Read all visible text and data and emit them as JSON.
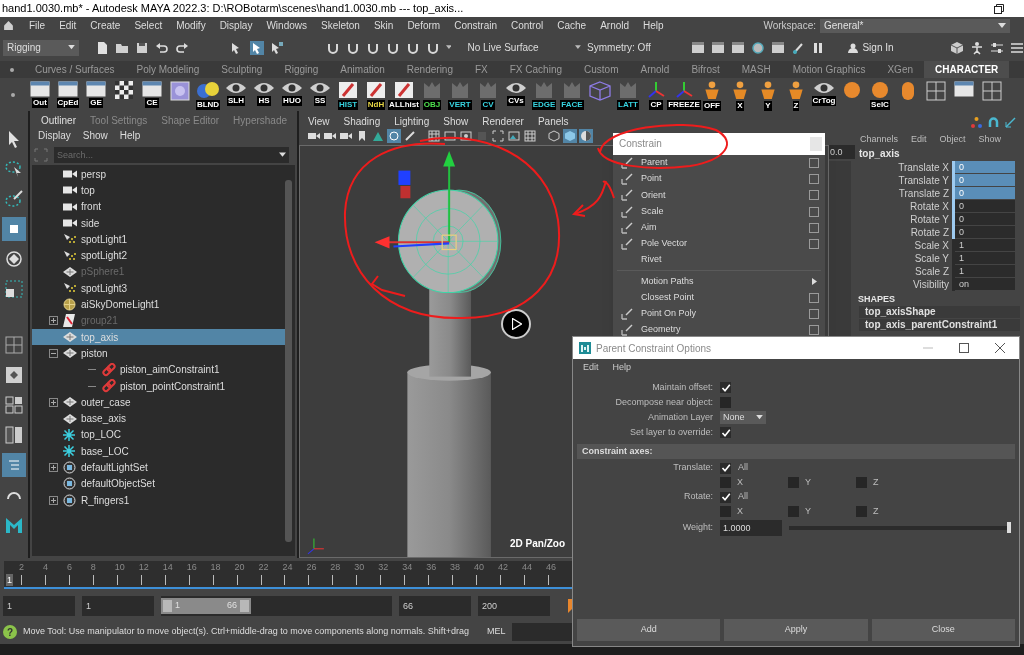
{
  "window": {
    "title": "hand1.0030.mb* - Autodesk MAYA 2022.3: D:\\ROBotarm\\scenes\\hand1.0030.mb   ---   top_axis..."
  },
  "menu_bar": {
    "items": [
      "File",
      "Edit",
      "Create",
      "Select",
      "Modify",
      "Display",
      "Windows",
      "Skeleton",
      "Skin",
      "Deform",
      "Constrain",
      "Control",
      "Cache",
      "Arnold",
      "Help"
    ],
    "workspace_label": "Workspace:",
    "workspace_value": "General*"
  },
  "status_line": {
    "menu_set": "Rigging",
    "live_surface": "No Live Surface",
    "symmetry": "Symmetry: Off",
    "sign_in": "Sign In"
  },
  "shelf": {
    "tabs": [
      {
        "label": "Curves / Surfaces",
        "selected": false
      },
      {
        "label": "Poly Modeling",
        "selected": false
      },
      {
        "label": "Sculpting",
        "selected": false
      },
      {
        "label": "Rigging",
        "selected": false
      },
      {
        "label": "Animation",
        "selected": false
      },
      {
        "label": "Rendering",
        "selected": false
      },
      {
        "label": "FX",
        "selected": false
      },
      {
        "label": "FX Caching",
        "selected": false
      },
      {
        "label": "Custom",
        "selected": false
      },
      {
        "label": "Arnold",
        "selected": false
      },
      {
        "label": "Bifrost",
        "selected": false
      },
      {
        "label": "MASH",
        "selected": false
      },
      {
        "label": "Motion Graphics",
        "selected": false
      },
      {
        "label": "XGen",
        "selected": false
      },
      {
        "label": "CHARACTER",
        "selected": true
      }
    ],
    "buttons": [
      {
        "kind": "window",
        "label": "Out"
      },
      {
        "kind": "window",
        "label": "CpEd"
      },
      {
        "kind": "window",
        "label": "GE"
      },
      {
        "kind": "checker"
      },
      {
        "kind": "window",
        "label": "CE"
      },
      {
        "kind": "swatch"
      },
      {
        "kind": "spheres",
        "label": "BLND"
      },
      {
        "kind": "eye",
        "label": "SLH"
      },
      {
        "kind": "eye",
        "label": "HS"
      },
      {
        "kind": "eye",
        "label": "HUO"
      },
      {
        "kind": "eye",
        "label": "SS"
      },
      {
        "kind": "history",
        "label": "HIST"
      },
      {
        "kind": "nodehistory",
        "label": "NdH"
      },
      {
        "kind": "allhistory",
        "label": "ALLhist"
      },
      {
        "kind": "object",
        "label": "OBJ"
      },
      {
        "kind": "component",
        "label": "VERT"
      },
      {
        "kind": "component",
        "label": "CV"
      },
      {
        "kind": "eye",
        "label": "CVs"
      },
      {
        "kind": "component",
        "label": "EDGE"
      },
      {
        "kind": "component",
        "label": "FACE"
      },
      {
        "kind": "cube"
      },
      {
        "kind": "component",
        "label": "LATT"
      },
      {
        "kind": "axes",
        "label": "CP"
      },
      {
        "kind": "axes",
        "label": "FREEZE"
      },
      {
        "kind": "figure",
        "label": "OFF"
      },
      {
        "kind": "figure",
        "label": "X"
      },
      {
        "kind": "figure",
        "label": "Y"
      },
      {
        "kind": "figure",
        "label": "Z"
      },
      {
        "kind": "eye",
        "label": "CrTog"
      },
      {
        "kind": "ball"
      },
      {
        "kind": "ball",
        "label": "SelC"
      },
      {
        "kind": "capsule"
      },
      {
        "kind": "grid"
      },
      {
        "kind": "window"
      },
      {
        "kind": "grid"
      }
    ]
  },
  "outliner": {
    "tabs": [
      {
        "label": "Outliner",
        "selected": true
      },
      {
        "label": "Tool Settings",
        "selected": false
      },
      {
        "label": "Shape Editor",
        "selected": false
      },
      {
        "label": "Hypershade",
        "selected": false
      }
    ],
    "menu": [
      "Display",
      "Show",
      "Help"
    ],
    "search": {
      "placeholder": "Search..."
    },
    "items": [
      {
        "label": "persp",
        "kind": "camera",
        "hidden": false,
        "selected": false
      },
      {
        "label": "top",
        "kind": "camera",
        "hidden": false,
        "selected": false
      },
      {
        "label": "front",
        "kind": "camera",
        "hidden": false,
        "selected": false
      },
      {
        "label": "side",
        "kind": "camera",
        "hidden": false,
        "selected": false
      },
      {
        "label": "spotLight1",
        "kind": "light",
        "hidden": false,
        "selected": false
      },
      {
        "label": "spotLight2",
        "kind": "light",
        "hidden": false,
        "selected": false
      },
      {
        "label": "pSphere1",
        "kind": "mesh",
        "hidden": true,
        "selected": false
      },
      {
        "label": "spotLight3",
        "kind": "light",
        "hidden": false,
        "selected": false
      },
      {
        "label": "aiSkyDomeLight1",
        "kind": "dome",
        "hidden": false,
        "selected": false
      },
      {
        "label": "group21",
        "kind": "group",
        "hidden": true,
        "selected": false,
        "expanded": false
      },
      {
        "label": "top_axis",
        "kind": "mesh",
        "hidden": false,
        "selected": true
      },
      {
        "label": "piston",
        "kind": "mesh",
        "hidden": false,
        "selected": false,
        "expanded": true,
        "children": [
          {
            "label": "piston_aimConstraint1",
            "kind": "constraint",
            "hidden": false,
            "selected": false
          },
          {
            "label": "piston_pointConstraint1",
            "kind": "constraint",
            "hidden": false,
            "selected": false
          }
        ]
      },
      {
        "label": "outer_case",
        "kind": "mesh",
        "hidden": false,
        "selected": false,
        "expanded": false
      },
      {
        "label": "base_axis",
        "kind": "mesh",
        "hidden": false,
        "selected": false
      },
      {
        "label": "top_LOC",
        "kind": "locator",
        "hidden": false,
        "selected": false
      },
      {
        "label": "base_LOC",
        "kind": "locator",
        "hidden": false,
        "selected": false
      },
      {
        "label": "defaultLightSet",
        "kind": "set",
        "hidden": false,
        "selected": false,
        "expanded": false
      },
      {
        "label": "defaultObjectSet",
        "kind": "set",
        "hidden": false,
        "selected": false
      },
      {
        "label": "R_fingers1",
        "kind": "set",
        "hidden": false,
        "selected": false,
        "expanded": false
      }
    ]
  },
  "viewport": {
    "menu": [
      "View",
      "Shading",
      "Lighting",
      "Show",
      "Renderer",
      "Panels"
    ],
    "camera_tool": "2D Pan/Zoo",
    "field_value": "0.0"
  },
  "channel_box": {
    "menu": [
      "Channels",
      "Edit",
      "Object",
      "Show"
    ],
    "object": "top_axis",
    "channels": [
      {
        "name": "Translate X",
        "value": "0",
        "selected": true,
        "marked": true
      },
      {
        "name": "Translate Y",
        "value": "0",
        "selected": true,
        "marked": true
      },
      {
        "name": "Translate Z",
        "value": "0",
        "selected": true,
        "marked": true
      },
      {
        "name": "Rotate X",
        "value": "0",
        "selected": false,
        "marked": true
      },
      {
        "name": "Rotate Y",
        "value": "0",
        "selected": false,
        "marked": true
      },
      {
        "name": "Rotate Z",
        "value": "0",
        "selected": false,
        "marked": true
      },
      {
        "name": "Scale X",
        "value": "1",
        "selected": false,
        "marked": false
      },
      {
        "name": "Scale Y",
        "value": "1",
        "selected": false,
        "marked": false
      },
      {
        "name": "Scale Z",
        "value": "1",
        "selected": false,
        "marked": false
      },
      {
        "name": "Visibility",
        "value": "on",
        "selected": false,
        "marked": false
      }
    ],
    "shapes_header": "SHAPES",
    "shapes": [
      "top_axisShape",
      "top_axis_parentConstraint1"
    ]
  },
  "constrain_menu": {
    "title": "Constrain",
    "items": [
      {
        "label": "Parent",
        "kind": "tool"
      },
      {
        "label": "Point",
        "kind": "tool"
      },
      {
        "label": "Orient",
        "kind": "tool"
      },
      {
        "label": "Scale",
        "kind": "tool"
      },
      {
        "label": "Aim",
        "kind": "tool"
      },
      {
        "label": "Pole Vector",
        "kind": "tool"
      },
      {
        "label": "Rivet",
        "kind": "plain"
      },
      {
        "kind": "divider"
      },
      {
        "label": "Motion Paths",
        "kind": "submenu"
      },
      {
        "label": "Closest Point",
        "kind": "option"
      },
      {
        "label": "Point On Poly",
        "kind": "tool"
      },
      {
        "label": "Geometry",
        "kind": "tool"
      }
    ]
  },
  "dialog": {
    "title": "Parent Constraint Options",
    "menu": [
      "Edit",
      "Help"
    ],
    "maintain_offset": {
      "label": "Maintain offset:",
      "checked": true
    },
    "decompose": {
      "label": "Decompose near object:",
      "checked": false
    },
    "animation_layer": {
      "label": "Animation Layer",
      "value": "None"
    },
    "override": {
      "label": "Set layer to override:",
      "checked": true
    },
    "section": "Constraint axes:",
    "axes": [
      {
        "label": "Translate:",
        "all": {
          "label": "All",
          "checked": true
        },
        "components": [
          {
            "label": "X",
            "checked": false
          },
          {
            "label": "Y",
            "checked": false
          },
          {
            "label": "Z",
            "checked": false
          }
        ]
      },
      {
        "label": "Rotate:",
        "all": {
          "label": "All",
          "checked": true
        },
        "components": [
          {
            "label": "X",
            "checked": false
          },
          {
            "label": "Y",
            "checked": false
          },
          {
            "label": "Z",
            "checked": false
          }
        ]
      }
    ],
    "weight": {
      "label": "Weight:",
      "value": "1.0000",
      "level": 1
    },
    "buttons": [
      "Add",
      "Apply",
      "Close"
    ]
  },
  "timeline": {
    "current": "1",
    "level": 0,
    "ticks": [
      "2",
      "4",
      "6",
      "8",
      "10",
      "12",
      "14",
      "16",
      "18",
      "20",
      "22",
      "24",
      "26",
      "28",
      "30",
      "32",
      "34",
      "36",
      "38",
      "40",
      "42",
      "44",
      "46"
    ]
  },
  "range": {
    "start": "1",
    "playback_start": "1",
    "slider_start": "1",
    "slider_end": "66",
    "playback_end": "66",
    "end": "200"
  },
  "help_line": {
    "glyph": "?",
    "message": "Move Tool: Use manipulator to move object(s). Ctrl+middle-drag to move components along normals. Shift+drag",
    "language": "MEL"
  }
}
